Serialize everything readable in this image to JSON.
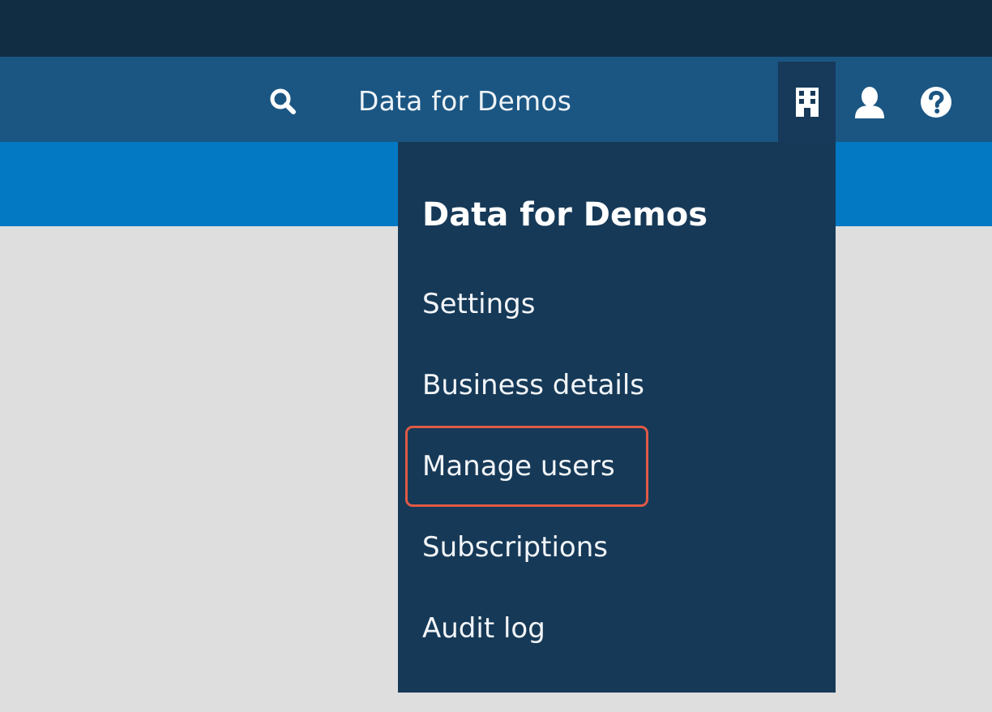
{
  "header": {
    "org_name": "Data for Demos"
  },
  "icons": {
    "search": "search-icon",
    "organization": "building-icon",
    "user": "user-icon",
    "help": "help-icon"
  },
  "dropdown": {
    "title": "Data for Demos",
    "items": [
      {
        "label": "Settings"
      },
      {
        "label": "Business details"
      },
      {
        "label": "Manage users",
        "highlighted": true
      },
      {
        "label": "Subscriptions"
      },
      {
        "label": "Audit log"
      }
    ]
  },
  "colors": {
    "topbar": "#112d44",
    "navbar": "#1b5683",
    "subbar": "#0279c2",
    "dropdown": "#163957",
    "highlight": "#e05a45",
    "content": "#dedede"
  }
}
